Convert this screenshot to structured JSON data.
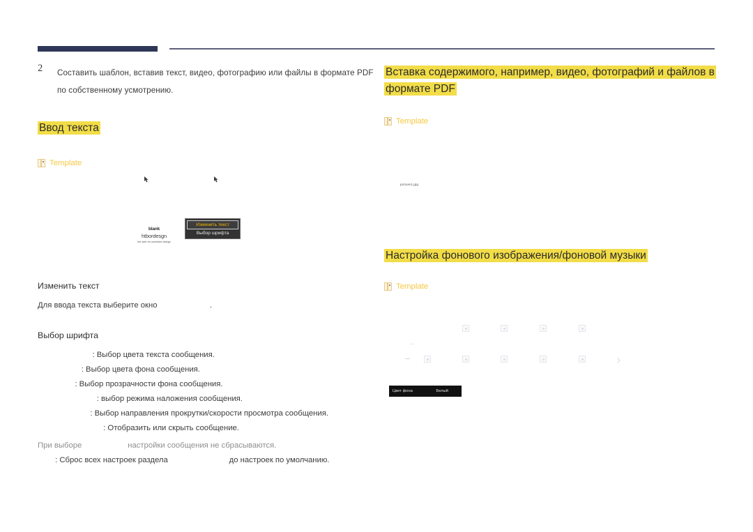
{
  "document": {
    "step": {
      "number": "2",
      "text": "Составить шаблон, вставив текст, видео, фотографию или файлы в формате PDF по собственному усмотрению."
    },
    "left_column": {
      "heading": "Ввод текста",
      "template_tag": "Template",
      "illustration": {
        "brand_line1": "blank",
        "brand_line2": "htbordesgn",
        "brand_line3": "the web for unlimited design",
        "context_menu": {
          "items": [
            {
              "label": "Изменить текст",
              "selected": true
            },
            {
              "label": "Выбор шрифта",
              "selected": false
            }
          ]
        },
        "cursor_icon_1": "pointer-cursor-icon",
        "cursor_icon_2": "pointer-cursor-icon"
      },
      "section_change_text": {
        "heading": "Изменить текст",
        "line": "Для ввода текста выберите окно                        ."
      },
      "section_font": {
        "heading": "Выбор шрифта",
        "lines": [
          "                         : Выбор цвета текста сообщения.",
          "                    : Выбор цвета фона сообщения.",
          "                 : Выбор прозрачности фона сообщения.",
          "                           : выбор режима наложения сообщения.",
          "                        : Выбор направления прокрутки/скорости просмотра сообщения.",
          "                              : Отобразить или скрыть сообщение."
        ],
        "note": "При выборе                     настройки сообщения не сбрасываются.",
        "reset_line": "        : Сброс всех настроек раздела                            до настроек по умолчанию."
      }
    },
    "right_column": {
      "heading_1": "Вставка содержимого, например, видео, фотографий и файлов в формате PDF",
      "template_tag_1": "Template",
      "picture_label": "picture1.jpg",
      "heading_2": "Настройка фонового изображения/фоновой музыки",
      "template_tag_2": "Template",
      "background_bar": {
        "label": "Цвет фона",
        "value": "Белый"
      },
      "back_arrow_icon": "back-arrow-icon",
      "next_chevron_icon": "chevron-right-icon"
    }
  },
  "colors": {
    "highlight": "#f2dd48",
    "rule_thick": "#2e3757",
    "rule_thin": "#5c5f79",
    "template_text": "#f5c842",
    "menu_selected_text": "#f2b400",
    "menu_background": "#333333",
    "bar_background": "#111111"
  }
}
